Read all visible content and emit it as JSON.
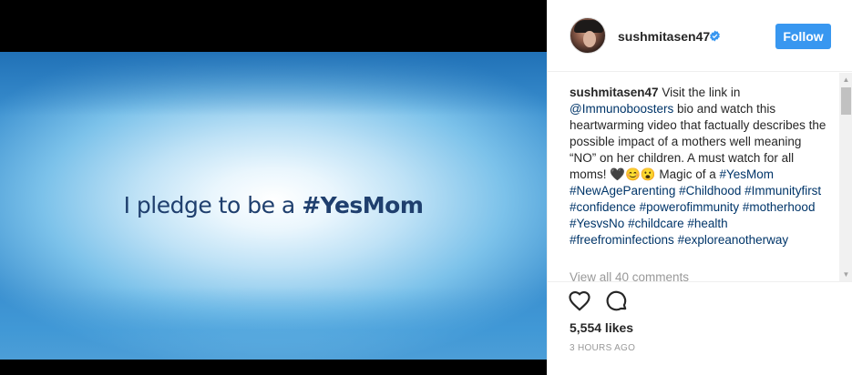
{
  "video": {
    "caption_prefix": "I pledge to be a ",
    "caption_hashtag": "#YesMom"
  },
  "header": {
    "username": "sushmitasen47",
    "verified_icon": "verified-badge-icon",
    "follow_label": "Follow"
  },
  "post": {
    "author": "sushmitasen47",
    "text_1": "Visit the link in",
    "mention": "@Immunoboosters",
    "text_2": "bio and watch this heartwarming video that factually describes the possible impact of a mothers well meaning “NO” on her children. A must watch for all moms! 🖤😊😮 Magic of a",
    "hashtags": [
      "#YesMom",
      "#NewAgeParenting",
      "#Childhood",
      "#Immunityfirst",
      "#confidence",
      "#powerofimmunity",
      "#motherhood",
      "#YesvsNo",
      "#childcare",
      "#health",
      "#freefrominfections",
      "#exploreanotherway"
    ],
    "view_all": "View all 40 comments"
  },
  "actions": {
    "like_icon": "heart-icon",
    "comment_icon": "comment-bubble-icon",
    "likes": "5,554 likes",
    "timestamp": "3 HOURS AGO"
  },
  "colors": {
    "follow_button": "#3897f0",
    "link": "#003569",
    "muted": "#999999"
  }
}
